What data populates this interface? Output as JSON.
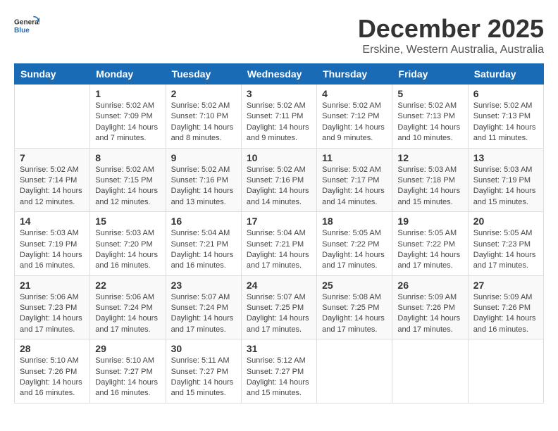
{
  "header": {
    "logo_line1": "General",
    "logo_line2": "Blue",
    "month": "December 2025",
    "location": "Erskine, Western Australia, Australia"
  },
  "weekdays": [
    "Sunday",
    "Monday",
    "Tuesday",
    "Wednesday",
    "Thursday",
    "Friday",
    "Saturday"
  ],
  "weeks": [
    [
      {
        "day": "",
        "sunrise": "",
        "sunset": "",
        "daylight": ""
      },
      {
        "day": "1",
        "sunrise": "Sunrise: 5:02 AM",
        "sunset": "Sunset: 7:09 PM",
        "daylight": "Daylight: 14 hours and 7 minutes."
      },
      {
        "day": "2",
        "sunrise": "Sunrise: 5:02 AM",
        "sunset": "Sunset: 7:10 PM",
        "daylight": "Daylight: 14 hours and 8 minutes."
      },
      {
        "day": "3",
        "sunrise": "Sunrise: 5:02 AM",
        "sunset": "Sunset: 7:11 PM",
        "daylight": "Daylight: 14 hours and 9 minutes."
      },
      {
        "day": "4",
        "sunrise": "Sunrise: 5:02 AM",
        "sunset": "Sunset: 7:12 PM",
        "daylight": "Daylight: 14 hours and 9 minutes."
      },
      {
        "day": "5",
        "sunrise": "Sunrise: 5:02 AM",
        "sunset": "Sunset: 7:13 PM",
        "daylight": "Daylight: 14 hours and 10 minutes."
      },
      {
        "day": "6",
        "sunrise": "Sunrise: 5:02 AM",
        "sunset": "Sunset: 7:13 PM",
        "daylight": "Daylight: 14 hours and 11 minutes."
      }
    ],
    [
      {
        "day": "7",
        "sunrise": "Sunrise: 5:02 AM",
        "sunset": "Sunset: 7:14 PM",
        "daylight": "Daylight: 14 hours and 12 minutes."
      },
      {
        "day": "8",
        "sunrise": "Sunrise: 5:02 AM",
        "sunset": "Sunset: 7:15 PM",
        "daylight": "Daylight: 14 hours and 12 minutes."
      },
      {
        "day": "9",
        "sunrise": "Sunrise: 5:02 AM",
        "sunset": "Sunset: 7:16 PM",
        "daylight": "Daylight: 14 hours and 13 minutes."
      },
      {
        "day": "10",
        "sunrise": "Sunrise: 5:02 AM",
        "sunset": "Sunset: 7:16 PM",
        "daylight": "Daylight: 14 hours and 14 minutes."
      },
      {
        "day": "11",
        "sunrise": "Sunrise: 5:02 AM",
        "sunset": "Sunset: 7:17 PM",
        "daylight": "Daylight: 14 hours and 14 minutes."
      },
      {
        "day": "12",
        "sunrise": "Sunrise: 5:03 AM",
        "sunset": "Sunset: 7:18 PM",
        "daylight": "Daylight: 14 hours and 15 minutes."
      },
      {
        "day": "13",
        "sunrise": "Sunrise: 5:03 AM",
        "sunset": "Sunset: 7:19 PM",
        "daylight": "Daylight: 14 hours and 15 minutes."
      }
    ],
    [
      {
        "day": "14",
        "sunrise": "Sunrise: 5:03 AM",
        "sunset": "Sunset: 7:19 PM",
        "daylight": "Daylight: 14 hours and 16 minutes."
      },
      {
        "day": "15",
        "sunrise": "Sunrise: 5:03 AM",
        "sunset": "Sunset: 7:20 PM",
        "daylight": "Daylight: 14 hours and 16 minutes."
      },
      {
        "day": "16",
        "sunrise": "Sunrise: 5:04 AM",
        "sunset": "Sunset: 7:21 PM",
        "daylight": "Daylight: 14 hours and 16 minutes."
      },
      {
        "day": "17",
        "sunrise": "Sunrise: 5:04 AM",
        "sunset": "Sunset: 7:21 PM",
        "daylight": "Daylight: 14 hours and 17 minutes."
      },
      {
        "day": "18",
        "sunrise": "Sunrise: 5:05 AM",
        "sunset": "Sunset: 7:22 PM",
        "daylight": "Daylight: 14 hours and 17 minutes."
      },
      {
        "day": "19",
        "sunrise": "Sunrise: 5:05 AM",
        "sunset": "Sunset: 7:22 PM",
        "daylight": "Daylight: 14 hours and 17 minutes."
      },
      {
        "day": "20",
        "sunrise": "Sunrise: 5:05 AM",
        "sunset": "Sunset: 7:23 PM",
        "daylight": "Daylight: 14 hours and 17 minutes."
      }
    ],
    [
      {
        "day": "21",
        "sunrise": "Sunrise: 5:06 AM",
        "sunset": "Sunset: 7:23 PM",
        "daylight": "Daylight: 14 hours and 17 minutes."
      },
      {
        "day": "22",
        "sunrise": "Sunrise: 5:06 AM",
        "sunset": "Sunset: 7:24 PM",
        "daylight": "Daylight: 14 hours and 17 minutes."
      },
      {
        "day": "23",
        "sunrise": "Sunrise: 5:07 AM",
        "sunset": "Sunset: 7:24 PM",
        "daylight": "Daylight: 14 hours and 17 minutes."
      },
      {
        "day": "24",
        "sunrise": "Sunrise: 5:07 AM",
        "sunset": "Sunset: 7:25 PM",
        "daylight": "Daylight: 14 hours and 17 minutes."
      },
      {
        "day": "25",
        "sunrise": "Sunrise: 5:08 AM",
        "sunset": "Sunset: 7:25 PM",
        "daylight": "Daylight: 14 hours and 17 minutes."
      },
      {
        "day": "26",
        "sunrise": "Sunrise: 5:09 AM",
        "sunset": "Sunset: 7:26 PM",
        "daylight": "Daylight: 14 hours and 17 minutes."
      },
      {
        "day": "27",
        "sunrise": "Sunrise: 5:09 AM",
        "sunset": "Sunset: 7:26 PM",
        "daylight": "Daylight: 14 hours and 16 minutes."
      }
    ],
    [
      {
        "day": "28",
        "sunrise": "Sunrise: 5:10 AM",
        "sunset": "Sunset: 7:26 PM",
        "daylight": "Daylight: 14 hours and 16 minutes."
      },
      {
        "day": "29",
        "sunrise": "Sunrise: 5:10 AM",
        "sunset": "Sunset: 7:27 PM",
        "daylight": "Daylight: 14 hours and 16 minutes."
      },
      {
        "day": "30",
        "sunrise": "Sunrise: 5:11 AM",
        "sunset": "Sunset: 7:27 PM",
        "daylight": "Daylight: 14 hours and 15 minutes."
      },
      {
        "day": "31",
        "sunrise": "Sunrise: 5:12 AM",
        "sunset": "Sunset: 7:27 PM",
        "daylight": "Daylight: 14 hours and 15 minutes."
      },
      {
        "day": "",
        "sunrise": "",
        "sunset": "",
        "daylight": ""
      },
      {
        "day": "",
        "sunrise": "",
        "sunset": "",
        "daylight": ""
      },
      {
        "day": "",
        "sunrise": "",
        "sunset": "",
        "daylight": ""
      }
    ]
  ]
}
